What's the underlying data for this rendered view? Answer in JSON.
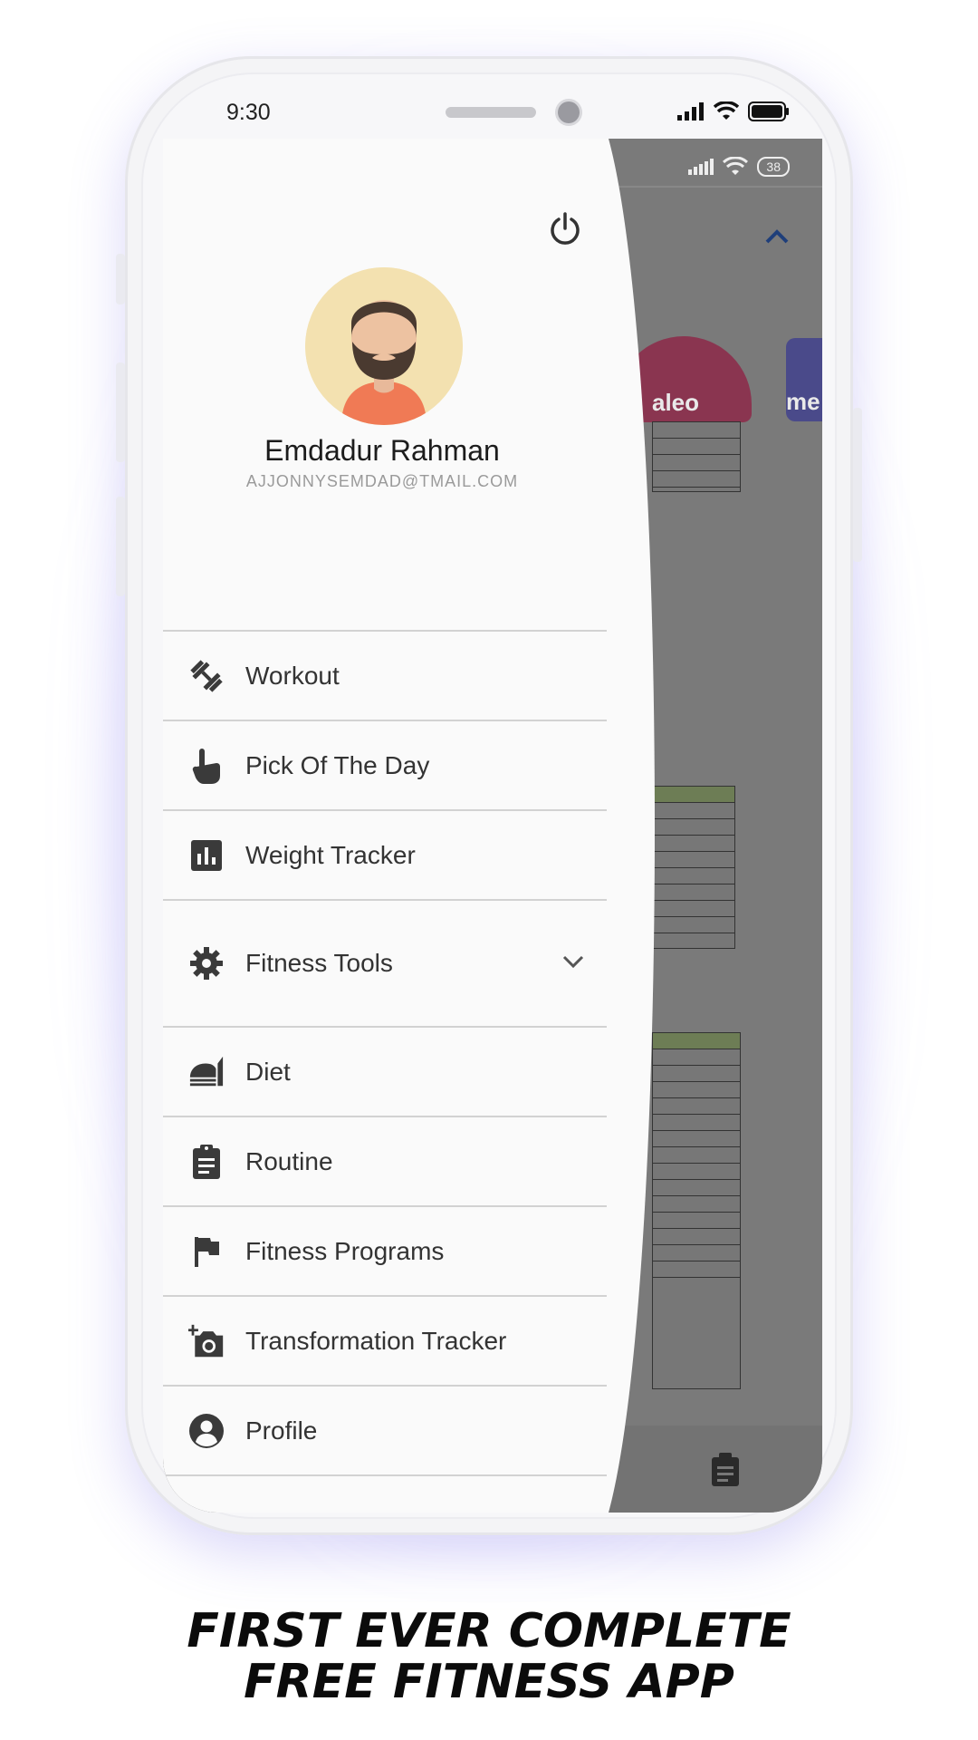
{
  "device": {
    "status_time": "9:30"
  },
  "background_app": {
    "battery_level": "38",
    "category_cards": [
      {
        "label": "aleo"
      },
      {
        "label": "me"
      }
    ]
  },
  "drawer": {
    "user": {
      "name": "Emdadur Rahman",
      "email": "AJJONNYSEMDAD@TMAIL.COM"
    },
    "menu_items": [
      {
        "label": "Workout",
        "icon": "dumbbell-icon"
      },
      {
        "label": "Pick Of The Day",
        "icon": "hand-pointer-icon"
      },
      {
        "label": "Weight Tracker",
        "icon": "bar-chart-icon"
      },
      {
        "label": "Fitness Tools",
        "icon": "gear-icon",
        "expandable": true
      },
      {
        "label": "Diet",
        "icon": "diet-icon"
      },
      {
        "label": "Routine",
        "icon": "clipboard-icon"
      },
      {
        "label": "Fitness Programs",
        "icon": "flag-icon"
      },
      {
        "label": "Transformation Tracker",
        "icon": "add-photo-icon"
      },
      {
        "label": "Profile",
        "icon": "account-circle-icon"
      }
    ]
  },
  "tagline": {
    "line1": "FIRST EVER COMPLETE",
    "line2": "FREE FITNESS APP"
  },
  "colors": {
    "drawer_background": "#fafafa",
    "scrim": "#7a7a7a",
    "accent_blue": "#1f3f7a",
    "icon_gray": "#3a3a3a"
  }
}
